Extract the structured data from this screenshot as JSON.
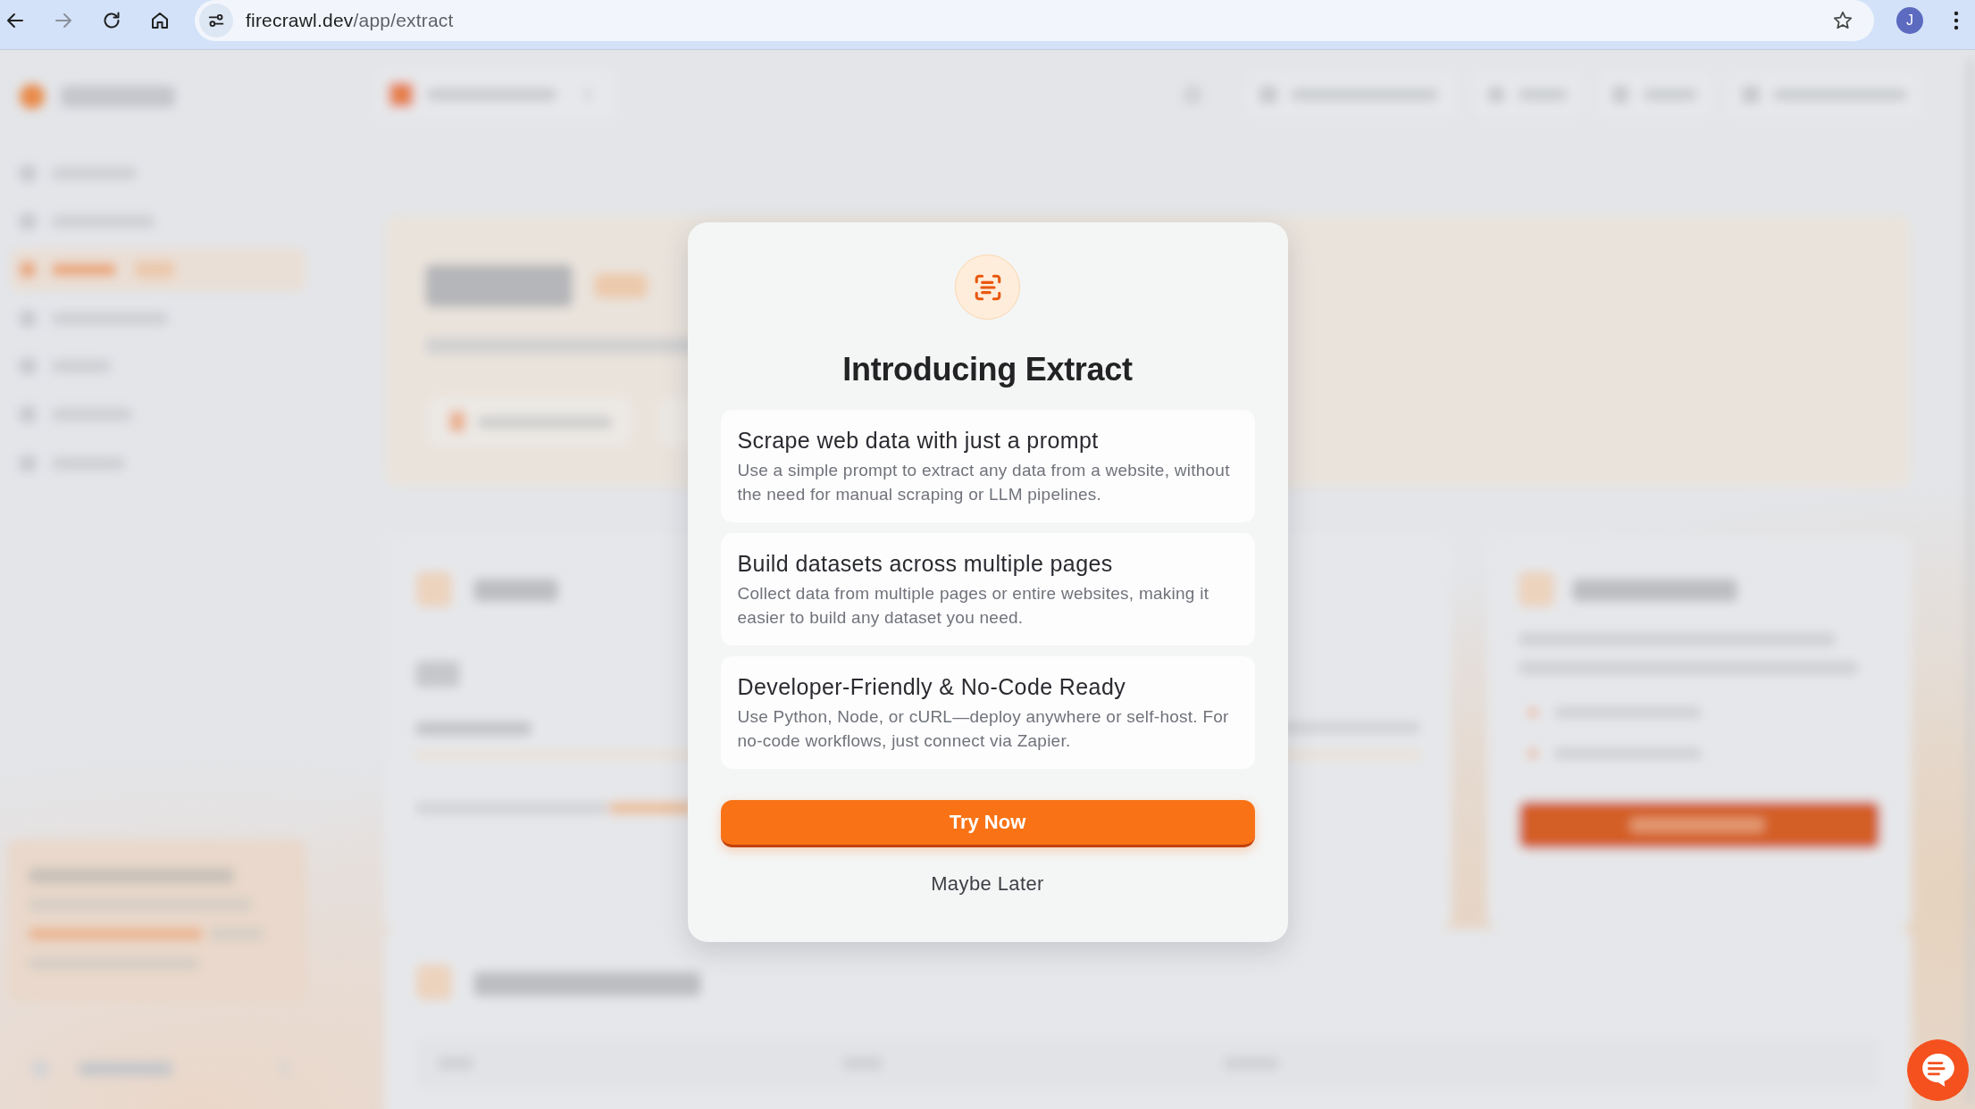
{
  "browser": {
    "nav_buttons": [
      {
        "kind": "back",
        "disabled": false
      },
      {
        "kind": "forward",
        "disabled": true
      },
      {
        "kind": "reload",
        "disabled": false
      },
      {
        "kind": "home",
        "disabled": false
      }
    ],
    "url": {
      "host": "firecrawl.dev",
      "path": "/app/extract"
    },
    "bookmarked": false,
    "profile_initial": "J"
  },
  "backdrop": {
    "blurred": true
  },
  "dialog": {
    "title": "Introducing Extract",
    "features": [
      {
        "title": "Scrape web data with just a prompt",
        "description": "Use a simple prompt to extract any data from a website, without the need for manual scraping or LLM pipelines."
      },
      {
        "title": "Build datasets across multiple pages",
        "description": "Collect data from multiple pages or entire websites, making it easier to build any dataset you need."
      },
      {
        "title": "Developer-Friendly & No-Code Ready",
        "description": "Use Python, Node, or cURL—deploy anywhere or self-host. For no-code workflows, just connect via Zapier."
      }
    ],
    "primary_button": "Try Now",
    "secondary_button": "Maybe Later"
  }
}
